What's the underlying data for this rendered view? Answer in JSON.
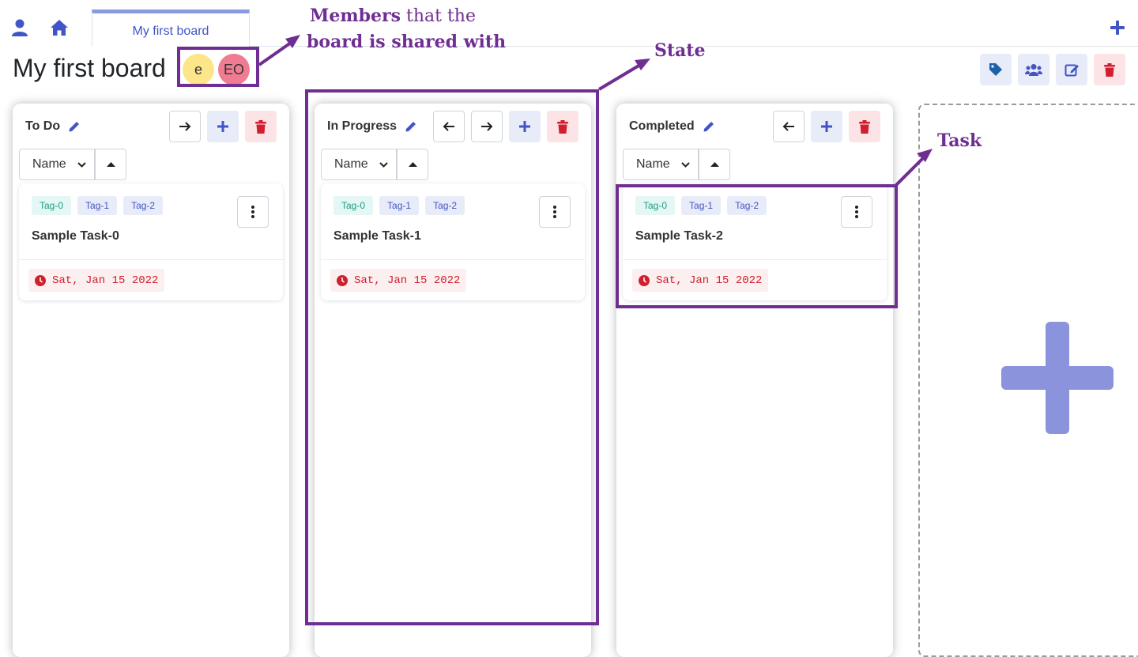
{
  "nav": {
    "board_tab_label": "My first board"
  },
  "board": {
    "title": "My first board",
    "members": [
      {
        "initials": "e",
        "color": "#fde58a"
      },
      {
        "initials": "EO",
        "color": "#f07c93"
      }
    ]
  },
  "sort": {
    "selected": "Name"
  },
  "columns": [
    {
      "name": "To Do",
      "task": {
        "tags": [
          "Tag-0",
          "Tag-1",
          "Tag-2"
        ],
        "title": "Sample Task-0",
        "due": "Sat, Jan 15 2022"
      }
    },
    {
      "name": "In Progress",
      "task": {
        "tags": [
          "Tag-0",
          "Tag-1",
          "Tag-2"
        ],
        "title": "Sample Task-1",
        "due": "Sat, Jan 15 2022"
      }
    },
    {
      "name": "Completed",
      "task": {
        "tags": [
          "Tag-0",
          "Tag-1",
          "Tag-2"
        ],
        "title": "Sample Task-2",
        "due": "Sat, Jan 15 2022"
      }
    }
  ],
  "annotations": {
    "members_bold": "Members",
    "members_rest": " that the",
    "members_line2": "board is shared with",
    "state": "State",
    "task": "Task"
  },
  "colors": {
    "primary": "#4155c7",
    "danger": "#d0202f",
    "annotation": "#6f2e92",
    "add_plus": "#8a93dc"
  }
}
